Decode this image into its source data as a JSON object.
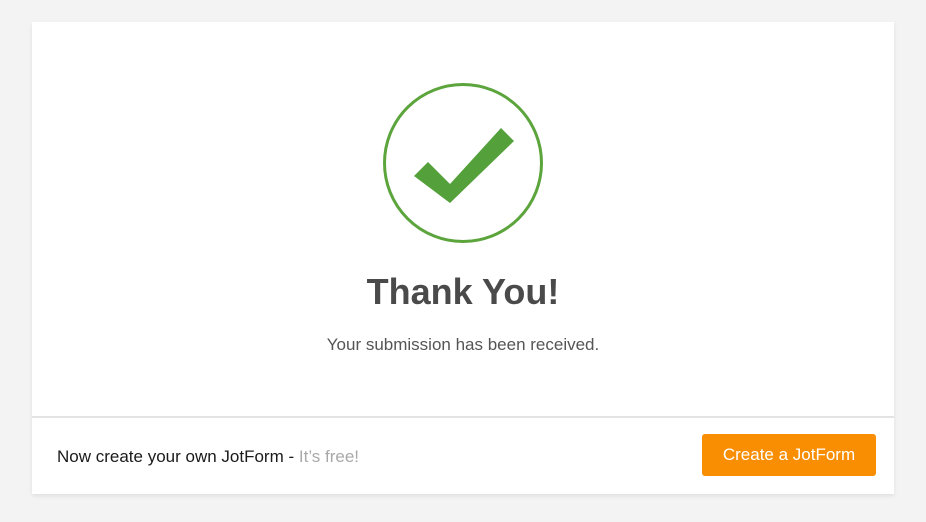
{
  "thank_you": {
    "title": "Thank You!",
    "message": "Your submission has been received.",
    "icon": "checkmark-icon",
    "icon_color": "#5ca43c"
  },
  "footer": {
    "promo_text": "Now create your own JotForm -",
    "promo_free": "It’s free!",
    "cta_label": "Create a JotForm",
    "cta_color": "#f98e03"
  }
}
